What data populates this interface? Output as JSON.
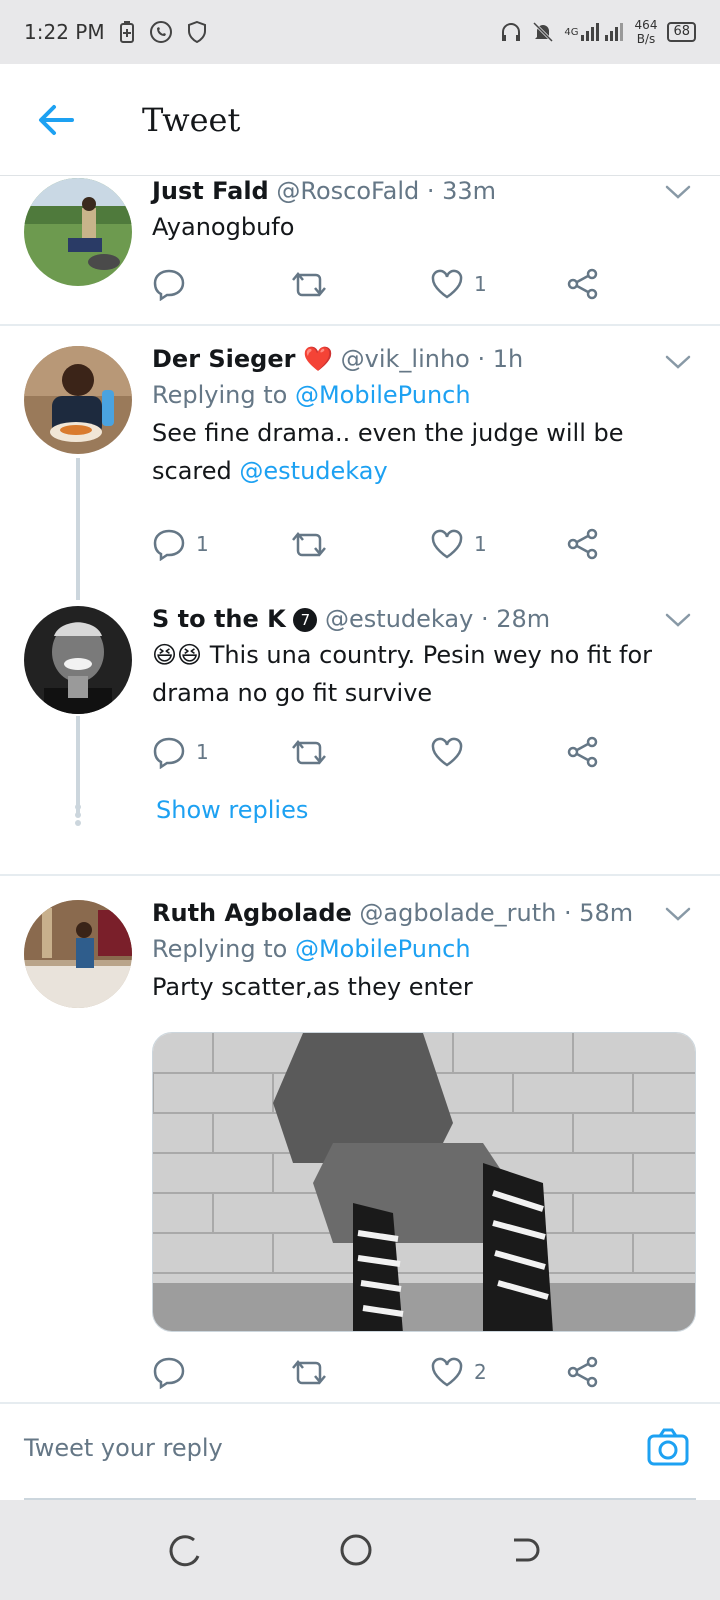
{
  "status_bar": {
    "time": "1:22 PM",
    "network": "4G",
    "speed_top": "464",
    "speed_bottom": "B/s",
    "battery": "68"
  },
  "header": {
    "title": "Tweet"
  },
  "tweets": [
    {
      "name": "Just Fald",
      "handle": "@RoscoFald",
      "time": "· 33m",
      "text": "Ayanogbufo",
      "replies": "",
      "likes": "1"
    },
    {
      "name": "Der Sieger",
      "badge": "❤️",
      "handle": "@vik_linho",
      "time": "· 1h",
      "reply_prefix": "Replying to",
      "reply_to": "@MobilePunch",
      "text": "See fine drama.. even the judge will be scared",
      "mention": "@estudekay",
      "replies": "1",
      "likes": "1"
    },
    {
      "name": "S to the K",
      "badge": "7",
      "handle": "@estudekay",
      "time": "· 28m",
      "emoji": "😆😆",
      "text": "This una country. Pesin wey no fit for drama no go fit survive",
      "replies": "1",
      "likes": "",
      "show_replies": "Show replies"
    },
    {
      "name": "Ruth Agbolade",
      "handle": "@agbolade_ruth",
      "time": "· 58m",
      "reply_prefix": "Replying to",
      "reply_to": "@MobilePunch",
      "text": "Party scatter,as they enter",
      "replies": "",
      "likes": "2"
    }
  ],
  "reply_bar": {
    "placeholder": "Tweet your reply"
  },
  "colors": {
    "accent": "#1da1f2",
    "secondary_text": "#657786",
    "heart": "#e0245e"
  }
}
